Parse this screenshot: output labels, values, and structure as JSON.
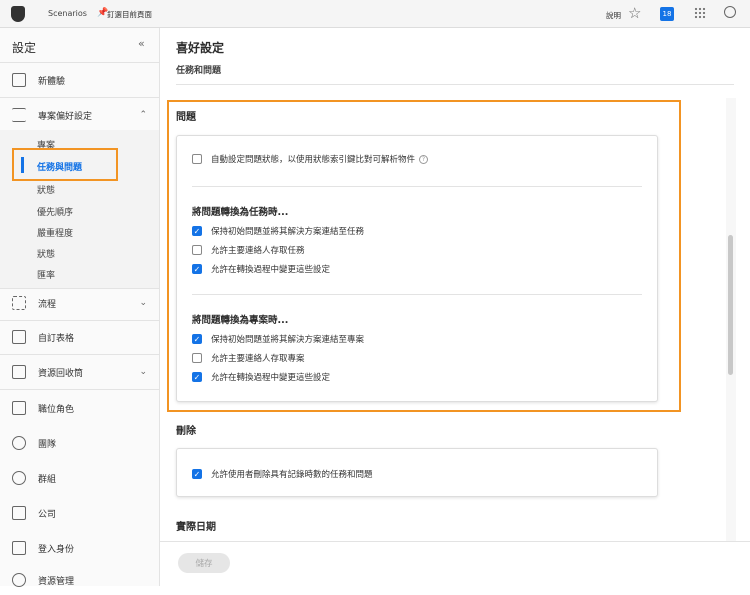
{
  "topbar": {
    "app": "Scenarios",
    "pin": "釘選目前頁面",
    "help": "說明",
    "badge": "18"
  },
  "sidebar": {
    "title": "設定",
    "items": [
      "新體驗",
      "專案偏好設定",
      "流程",
      "自訂表格",
      "資源回收筒",
      "職位角色",
      "團隊",
      "群組",
      "公司",
      "登入身份",
      "資源管理"
    ],
    "sub": [
      "專案",
      "任務與問題",
      "狀態",
      "優先順序",
      "嚴重程度",
      "狀態",
      "匯率"
    ]
  },
  "main": {
    "title": "喜好設定",
    "subtitle": "任務和問題",
    "issues": {
      "heading": "問題",
      "auto": "自動設定問題狀態，以使用狀態索引鍵比對可解析物件",
      "task_heading": "將問題轉換為任務時...",
      "task_opts": [
        "保持初始問題並將其解決方案連結至任務",
        "允許主要連絡人存取任務",
        "允許在轉換過程中變更這些設定"
      ],
      "proj_heading": "將問題轉換為專案時...",
      "proj_opts": [
        "保持初始問題並將其解決方案連結至專案",
        "允許主要連絡人存取專案",
        "允許在轉換過程中變更這些設定"
      ]
    },
    "delete": {
      "heading": "刪除",
      "opt": "允許使用者刪除具有記錄時數的任務和問題"
    },
    "actual": {
      "heading": "實際日期"
    },
    "save": "儲存"
  },
  "colors": {
    "accent": "#1473e6",
    "highlight": "#f29423"
  }
}
